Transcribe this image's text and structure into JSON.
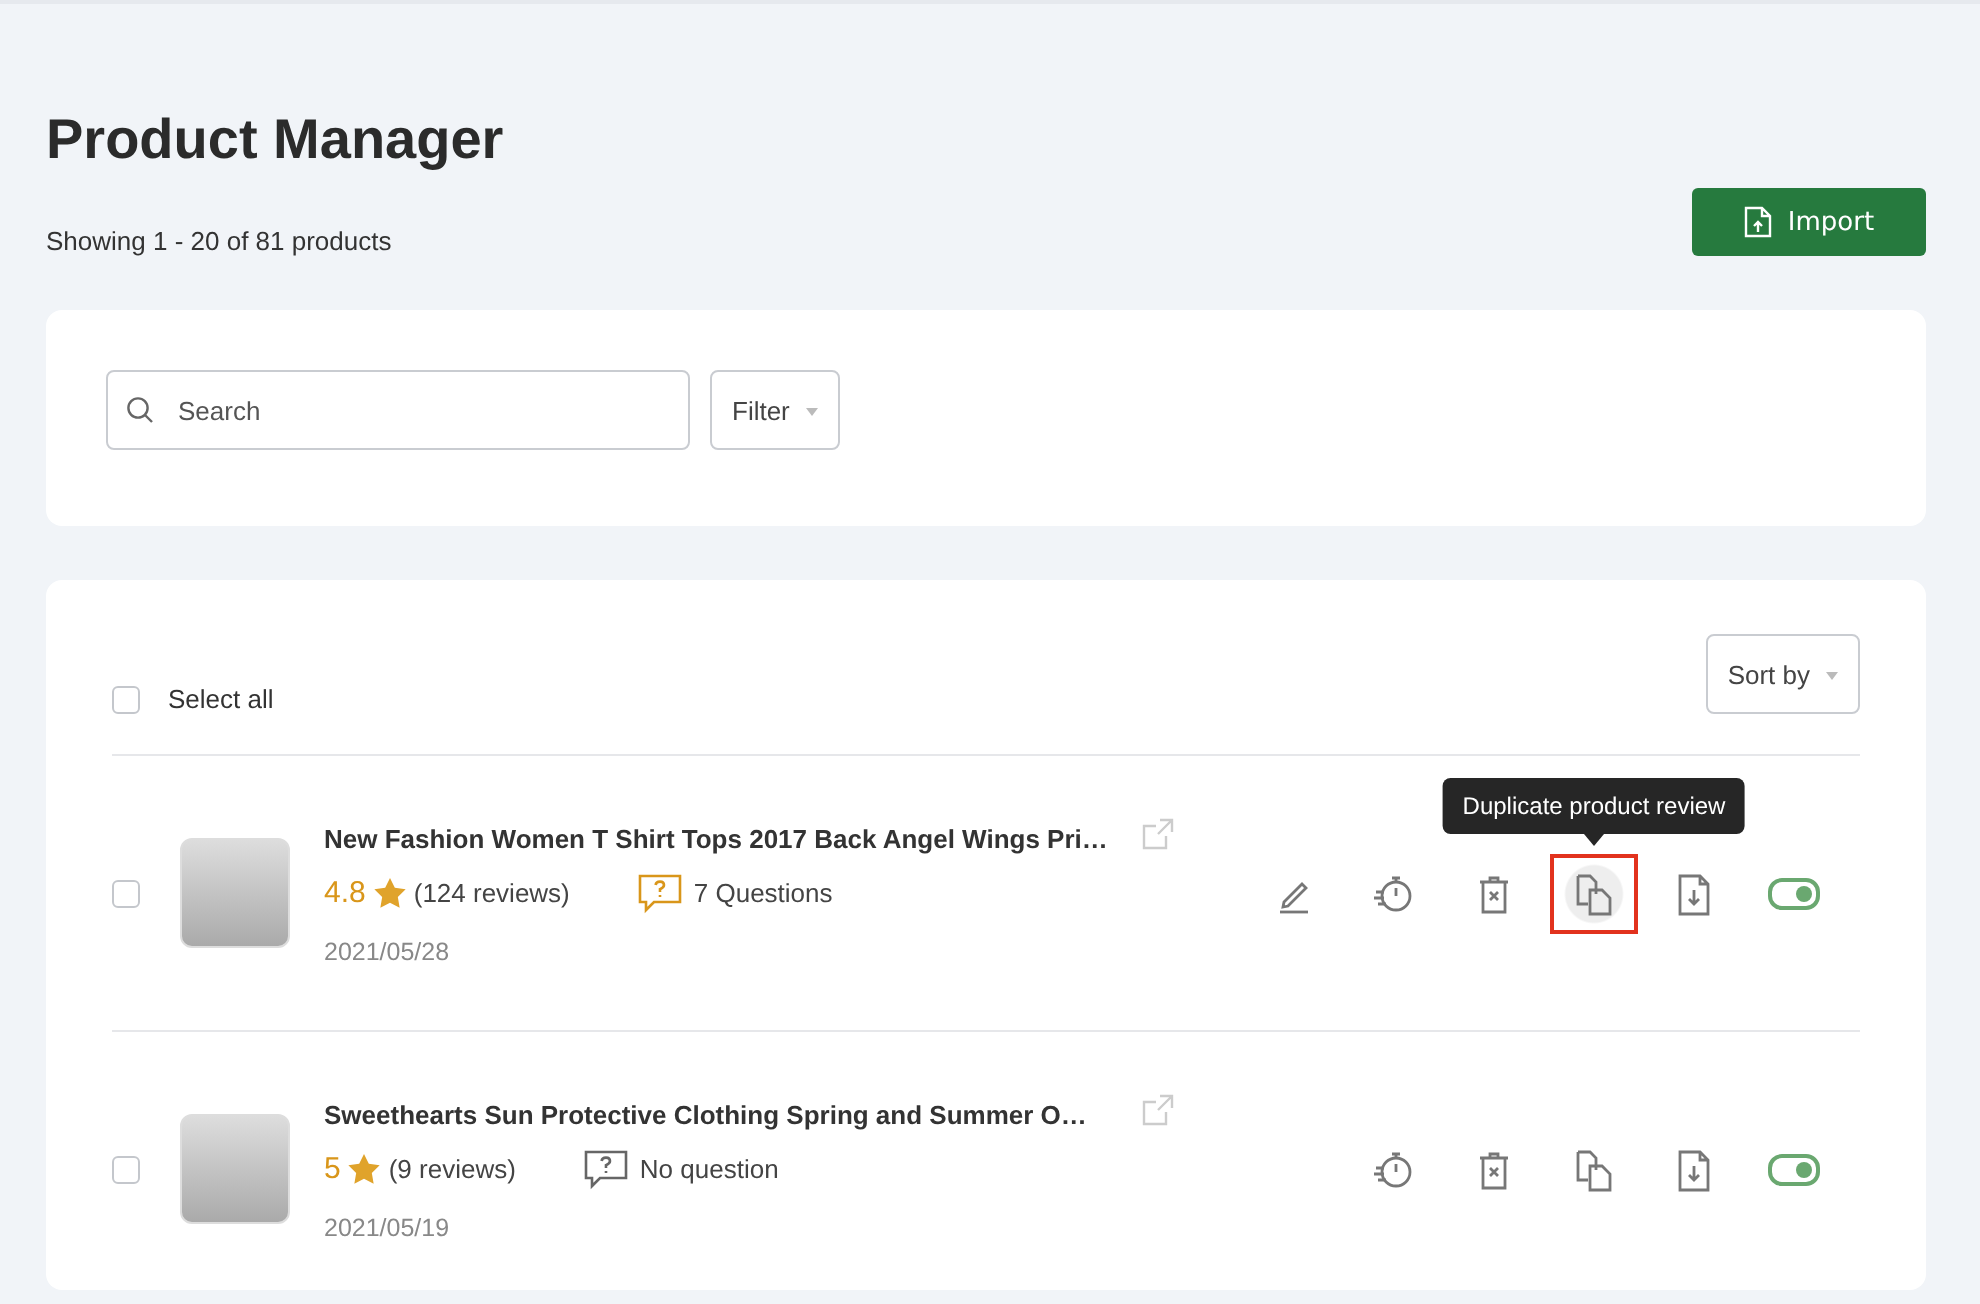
{
  "page": {
    "title": "Product Manager",
    "summary": "Showing 1 - 20 of 81 products",
    "import_button": "Import"
  },
  "search": {
    "placeholder": "Search",
    "filter": "Filter"
  },
  "list": {
    "select_all": {
      "label": "Select all",
      "checked": false
    },
    "sort": "Sort by"
  },
  "products": [
    {
      "title": "New Fashion Women T Shirt Tops 2017 Back Angel Wings Pri…",
      "rating": "4.8",
      "reviews": "(124 reviews)",
      "questions": "7 Questions",
      "has_questions": true,
      "date": "2021/05/28",
      "checked": false,
      "enabled": true,
      "tooltip": "Duplicate product review",
      "actions": [
        {
          "kind": "edit",
          "highlighted": false
        },
        {
          "kind": "schedule",
          "highlighted": false
        },
        {
          "kind": "delete",
          "highlighted": false
        },
        {
          "kind": "duplicate",
          "highlighted": true
        },
        {
          "kind": "download",
          "highlighted": false
        }
      ]
    },
    {
      "title": "Sweethearts Sun Protective Clothing Spring and Summer O…",
      "rating": "5",
      "reviews": "(9 reviews)",
      "questions": "No question",
      "has_questions": false,
      "date": "2021/05/19",
      "checked": false,
      "enabled": true,
      "actions": [
        {
          "kind": "schedule",
          "highlighted": false
        },
        {
          "kind": "delete",
          "highlighted": false
        },
        {
          "kind": "duplicate",
          "highlighted": false
        },
        {
          "kind": "download",
          "highlighted": false
        }
      ]
    }
  ]
}
